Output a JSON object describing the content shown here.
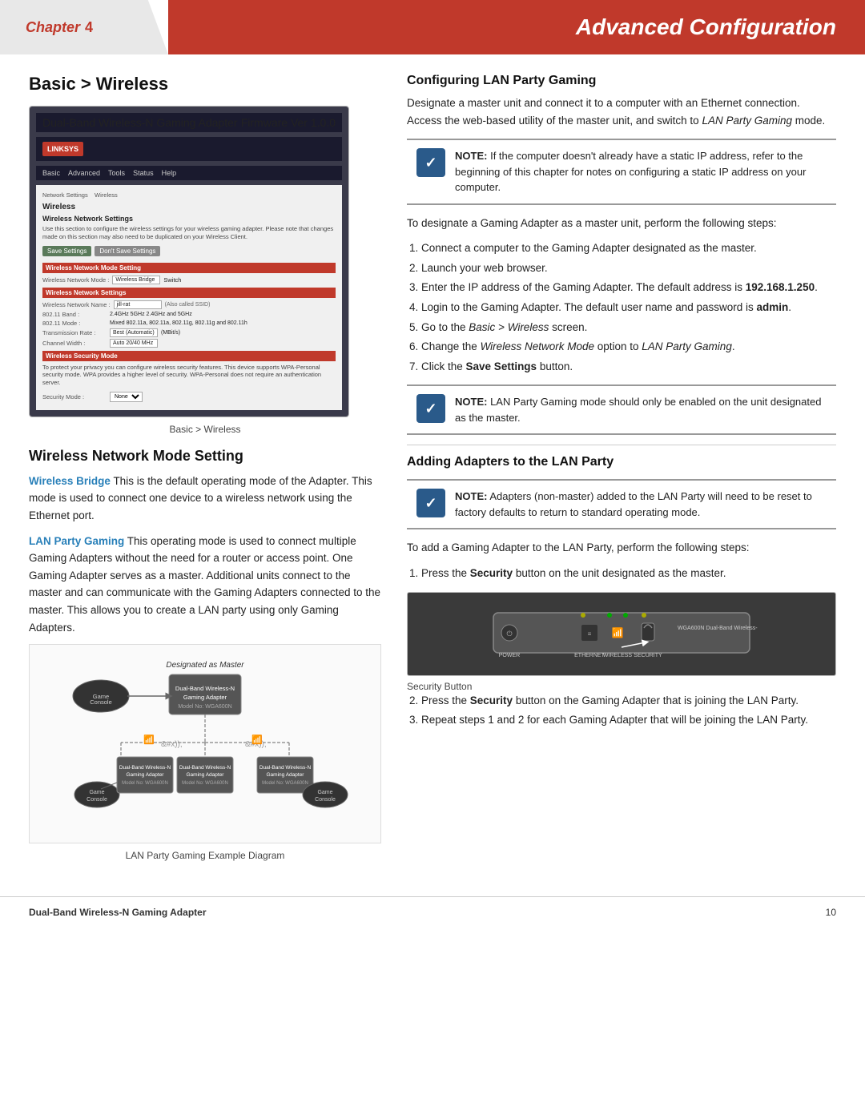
{
  "header": {
    "chapter_word": "Chapter",
    "chapter_number": "4",
    "title": "Advanced Configuration"
  },
  "left": {
    "section_title": "Basic > Wireless",
    "screenshot_caption": "Basic > Wireless",
    "subsection_title": "Wireless Network Mode Setting",
    "wireless_bridge_label": "Wireless Bridge",
    "wireless_bridge_text": "This is the default operating mode of the Adapter. This mode is used to connect one device to a wireless network using the Ethernet port.",
    "lan_party_label": "LAN Party Gaming",
    "lan_party_text": "This operating mode is used to connect multiple Gaming Adapters without the need for a router or access point. One Gaming Adapter serves as a master. Additional units connect to the master and can communicate with the Gaming Adapters connected to the master. This allows you to create a LAN party using only Gaming Adapters.",
    "diagram_caption": "LAN Party Gaming Example Diagram",
    "screenshot": {
      "header_left": "Dual-Band Wireless-N Gaming Adapter",
      "header_right": "Firmware Ver 1.0.0",
      "logo": "LINKSYS",
      "nav_items": [
        "Basic",
        "Advanced",
        "Tools",
        "Status",
        "Help"
      ],
      "submenu": "Network Settings    Wireless",
      "content_title": "Wireless",
      "content_subtitle": "Wireless Network Settings",
      "content_desc": "Use this section to configure the wireless settings for your wireless gaming adapter. Please note that changes made on this section may also need to be duplicated on your Wireless Client.",
      "btn_save": "Save Settings",
      "btn_dont": "Don't Save Settings",
      "mode_section": "Wireless Network Mode Setting",
      "network_mode_label": "Wireless Network Mode :",
      "network_mode_value": "Wireless Bridge",
      "switch_label": "Switch",
      "network_settings_section": "Wireless Network Settings",
      "ssid_label": "Wireless Network Name :",
      "ssid_value": "jill-rat",
      "ssid_note": "(Also called SSID)",
      "band_label": "802.11 Band :",
      "band_value": "2.4GHz   5GHz   2.4GHz and 5GHz",
      "mode_label": "802.11 Mode :",
      "mode_value": "Mixed 802.11a, 802.11a, 802.11g, 802.11g and 802.11h",
      "rate_label": "Transmission Rate :",
      "rate_value": "Best (Automatic)",
      "rate_extra": "(MBit/s)",
      "width_label": "Channel Width :",
      "width_value": "Auto 20/40 MHz",
      "security_section": "Wireless Security Mode",
      "security_desc": "To protect your privacy you can configure wireless security features. This device supports WPA-Personal security mode. WPA provides a higher level of security. WPA-Personal does not require an authentication server.",
      "security_mode_label": "Security Mode :",
      "security_mode_value": "None"
    }
  },
  "right": {
    "section1_title": "Configuring LAN Party Gaming",
    "section1_intro": "Designate a master unit and connect it to a computer with an Ethernet connection. Access the web-based utility of the master unit, and switch to",
    "section1_intro_italic": "LAN Party Gaming",
    "section1_intro_end": "mode.",
    "note1_label": "NOTE:",
    "note1_text": "If the computer doesn't already have a static IP address, refer to the beginning of this chapter for notes on configuring a static IP address on your computer.",
    "section1_steps_intro": "To designate a Gaming Adapter as a master unit, perform the following steps:",
    "steps1": [
      "Connect a computer to the Gaming Adapter designated as the master.",
      "Launch your web browser.",
      "Enter the IP address of the Gaming Adapter. The default address is 192.168.1.250.",
      "Login to the Gaming Adapter. The default user name and password is admin.",
      "Go to the Basic > Wireless screen.",
      "Change the Wireless Network Mode option to LAN Party Gaming.",
      "Click the Save Settings button."
    ],
    "steps1_bold_ip": "192.168.1.250",
    "steps1_bold_admin": "admin",
    "steps1_italic_basic": "Basic > Wireless",
    "steps1_italic_mode": "Wireless Network Mode",
    "steps1_italic_gaming": "LAN Party Gaming",
    "steps1_bold_save": "Save Settings",
    "note2_label": "NOTE:",
    "note2_text": "LAN Party Gaming mode should only be enabled on the unit designated as the master.",
    "section2_title": "Adding Adapters to the LAN Party",
    "note3_label": "NOTE:",
    "note3_text": "Adapters (non-master) added to the LAN Party will need to be reset to factory defaults to return to standard operating mode.",
    "section2_intro": "To add a Gaming Adapter to the LAN Party, perform the following steps:",
    "steps2": [
      "Press the Security button on the unit designated as the master.",
      "Press the Security button on the Gaming Adapter that is joining the LAN Party.",
      "Repeat steps 1 and 2 for each Gaming Adapter that will be joining the LAN Party."
    ],
    "steps2_bold_security": "Security",
    "security_caption": "Security Button"
  },
  "footer": {
    "product": "Dual-Band Wireless-N Gaming Adapter",
    "page": "10"
  }
}
